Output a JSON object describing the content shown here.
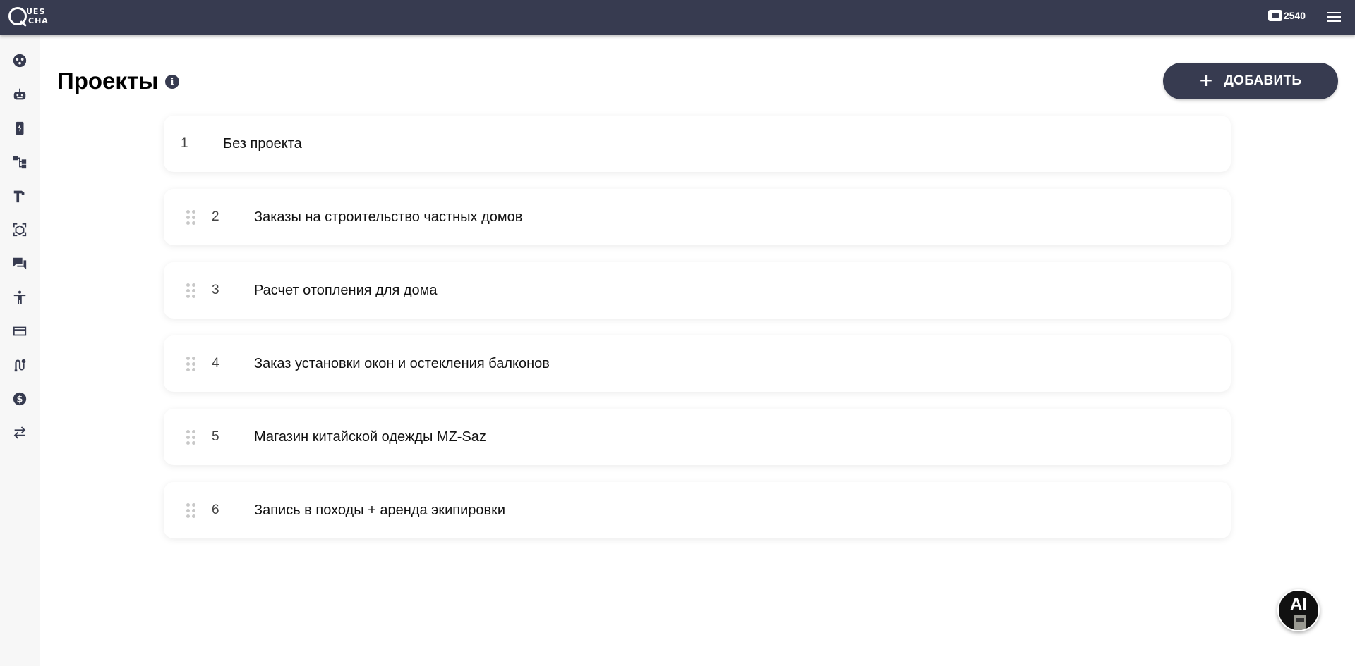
{
  "header": {
    "logo_line1": "UES",
    "logo_line2": "CHA",
    "balance": "2540",
    "balance_icon": "wallet-icon",
    "menu_icon": "menu-icon"
  },
  "sidebar": {
    "items": [
      {
        "icon": "dashboard-icon"
      },
      {
        "icon": "robot-icon"
      },
      {
        "icon": "device-icon"
      },
      {
        "icon": "hierarchy-icon"
      },
      {
        "icon": "hammer-icon"
      },
      {
        "icon": "cube-icon"
      },
      {
        "icon": "chat-icon"
      },
      {
        "icon": "accessibility-icon"
      },
      {
        "icon": "credit-card-icon"
      },
      {
        "icon": "route-icon"
      },
      {
        "icon": "dollar-icon"
      },
      {
        "icon": "swap-icon"
      }
    ]
  },
  "main": {
    "title": "Проекты",
    "info_icon": "i",
    "add_label": "ДОБАВИТЬ",
    "add_icon": "+"
  },
  "projects": [
    {
      "num": "1",
      "name": "Без проекта",
      "draggable": false
    },
    {
      "num": "2",
      "name": "Заказы на строительство частных домов",
      "draggable": true
    },
    {
      "num": "3",
      "name": "Расчет отопления для дома",
      "draggable": true
    },
    {
      "num": "4",
      "name": "Заказ установки окон и остекления балконов",
      "draggable": true
    },
    {
      "num": "5",
      "name": "Магазин китайской одежды MZ-Saz",
      "draggable": true
    },
    {
      "num": "6",
      "name": "Запись в походы + аренда экипировки",
      "draggable": true
    }
  ],
  "ai_button": {
    "label": "AI"
  },
  "colors": {
    "primary": "#373b50",
    "background": "#ffffff",
    "sidebar": "#f7f7f7"
  }
}
